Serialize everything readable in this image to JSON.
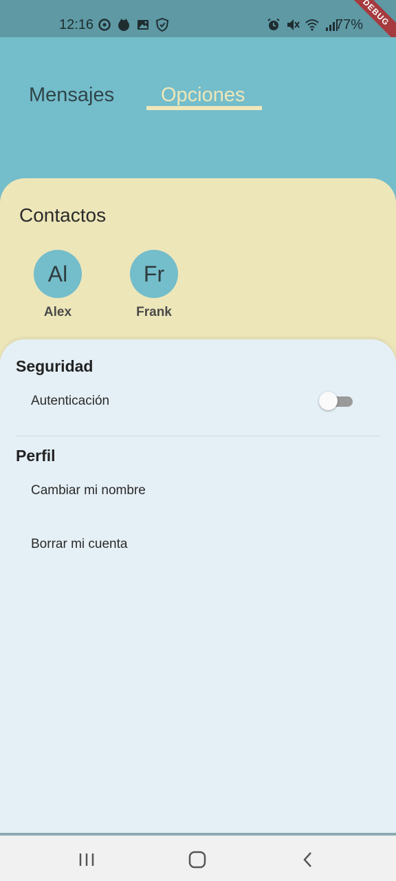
{
  "status_bar": {
    "time": "12:16",
    "battery": "77%",
    "left_icons": [
      "sync-icon",
      "fox-icon",
      "image-icon",
      "shield-icon"
    ],
    "right_icons": [
      "alarm-icon",
      "mute-icon",
      "wifi-icon",
      "signal-icon"
    ]
  },
  "debug_banner": "DEBUG",
  "tabs": [
    {
      "label": "Mensajes",
      "selected": false
    },
    {
      "label": "Opciones",
      "selected": true
    }
  ],
  "contacts": {
    "title": "Contactos",
    "items": [
      {
        "initials": "Al",
        "name": "Alex"
      },
      {
        "initials": "Fr",
        "name": "Frank"
      }
    ]
  },
  "settings": {
    "security": {
      "title": "Seguridad",
      "authentication_label": "Autenticación",
      "authentication_enabled": false
    },
    "profile": {
      "title": "Perfil",
      "change_name_label": "Cambiar mi nombre",
      "delete_account_label": "Borrar mi cuenta"
    }
  },
  "colors": {
    "app_bar": "#74bdcb",
    "tab_selected": "#eee7b9",
    "contacts_background": "#ede6b9",
    "settings_background": "#e5f0f6"
  },
  "nav_bar": [
    "recents-icon",
    "home-icon",
    "back-icon"
  ]
}
